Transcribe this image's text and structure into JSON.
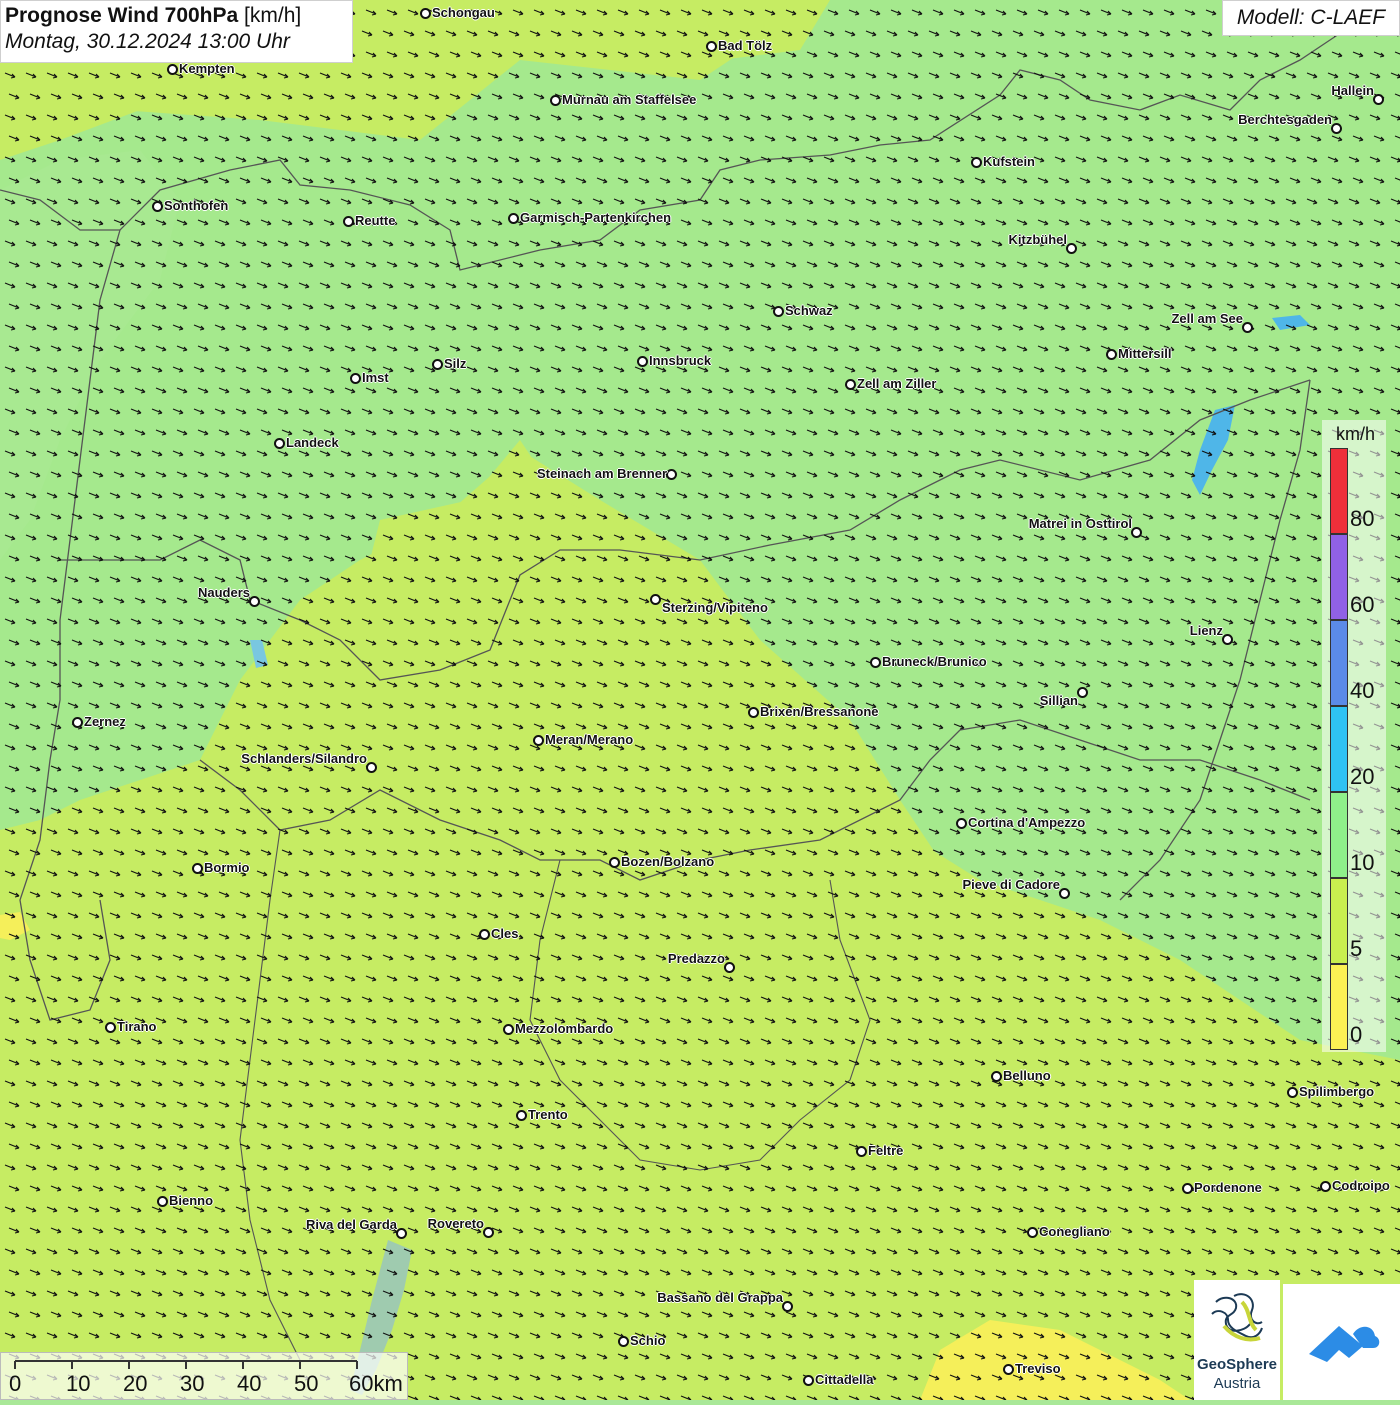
{
  "title": {
    "main_bold": "Prognose Wind 700hPa",
    "main_unit": "[km/h]",
    "datetime": "Montag, 30.12.2024 13:00 Uhr"
  },
  "model": "Modell: C-LAEF",
  "legend": {
    "unit": "km/h",
    "ticks": [
      "0",
      "5",
      "10",
      "20",
      "40",
      "60",
      "80"
    ],
    "colors": [
      "#fcf154",
      "#c9ef4f",
      "#8ff08a",
      "#2fc3f3",
      "#5b8be8",
      "#9061e6",
      "#ee2f3a"
    ]
  },
  "scalebar": {
    "ticks": [
      "0",
      "10",
      "20",
      "30",
      "40",
      "50",
      "60km"
    ]
  },
  "logos": {
    "geosphere_line1": "GeoSphere",
    "geosphere_line2": "Austria"
  },
  "cities": [
    {
      "name": "Schongau"
    },
    {
      "name": "Bad Tölz"
    },
    {
      "name": "Kempten"
    },
    {
      "name": "Murnau am Staffelsee"
    },
    {
      "name": "Hallein"
    },
    {
      "name": "Berchtesgaden"
    },
    {
      "name": "Kufstein"
    },
    {
      "name": "Sonthofen"
    },
    {
      "name": "Reutte"
    },
    {
      "name": "Garmisch-Partenkirchen"
    },
    {
      "name": "Kitzbühel"
    },
    {
      "name": "Schwaz"
    },
    {
      "name": "Zell am See"
    },
    {
      "name": "Mittersill"
    },
    {
      "name": "Silz"
    },
    {
      "name": "Innsbruck"
    },
    {
      "name": "Imst"
    },
    {
      "name": "Zell am Ziller"
    },
    {
      "name": "Landeck"
    },
    {
      "name": "Steinach am Brenner"
    },
    {
      "name": "Matrei in Osttirol"
    },
    {
      "name": "Nauders"
    },
    {
      "name": "Sterzing/Vipiteno"
    },
    {
      "name": "Lienz"
    },
    {
      "name": "Bruneck/Brunico"
    },
    {
      "name": "Sillian"
    },
    {
      "name": "Brixen/Bressanone"
    },
    {
      "name": "Zernez"
    },
    {
      "name": "Meran/Merano"
    },
    {
      "name": "Schlanders/Silandro"
    },
    {
      "name": "Cortina d'Ampezzo"
    },
    {
      "name": "Bozen/Bolzano"
    },
    {
      "name": "Bormio"
    },
    {
      "name": "Pieve di Cadore"
    },
    {
      "name": "Cles"
    },
    {
      "name": "Predazzo"
    },
    {
      "name": "Tirano"
    },
    {
      "name": "Mezzolombardo"
    },
    {
      "name": "Belluno"
    },
    {
      "name": "Spilimbergo"
    },
    {
      "name": "Trento"
    },
    {
      "name": "Feltre"
    },
    {
      "name": "Pordenone"
    },
    {
      "name": "Codroipo"
    },
    {
      "name": "Bienno"
    },
    {
      "name": "Riva del Garda"
    },
    {
      "name": "Rovereto"
    },
    {
      "name": "Conegliano"
    },
    {
      "name": "Bassano del Grappa"
    },
    {
      "name": "Schio"
    },
    {
      "name": "Treviso"
    },
    {
      "name": "Cittadella"
    }
  ]
}
